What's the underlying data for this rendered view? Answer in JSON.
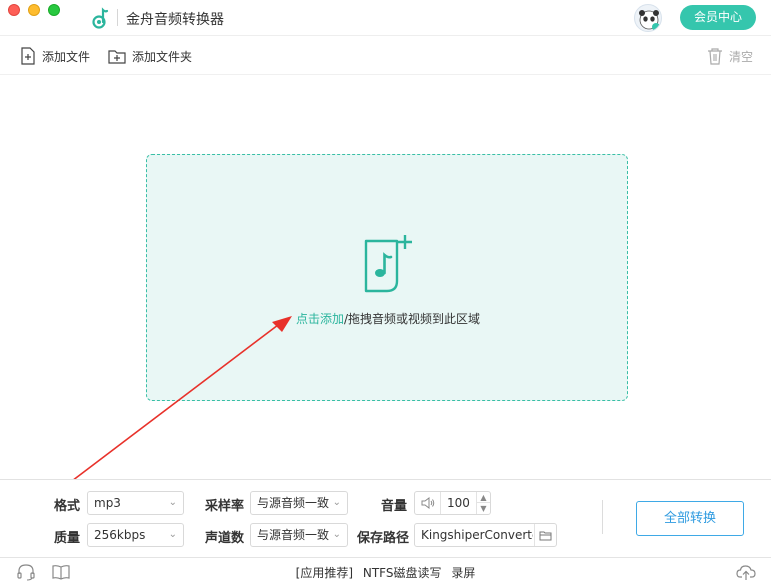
{
  "window": {
    "title": "金舟音频转换器",
    "vip_button": "会员中心"
  },
  "toolbar": {
    "add_file": "添加文件",
    "add_folder": "添加文件夹",
    "clear": "清空"
  },
  "dropzone": {
    "link_text": "点击添加",
    "rest_text": "/拖拽音频或视频到此区域"
  },
  "settings": {
    "format_label": "格式",
    "format_value": "mp3",
    "quality_label": "质量",
    "quality_value": "256kbps",
    "sample_rate_label": "采样率",
    "sample_rate_value": "与源音频一致",
    "channels_label": "声道数",
    "channels_value": "与源音频一致",
    "volume_label": "音量",
    "volume_value": "100",
    "save_path_label": "保存路径",
    "save_path_value": "KingshiperConverter",
    "convert_all_button": "全部转换"
  },
  "statusbar": {
    "app_recommend": "[应用推荐]",
    "ntfs": "NTFS磁盘读写",
    "screen_record": "录屏"
  },
  "colors": {
    "accent": "#35c6ad",
    "dropzone_bg": "#e9f7f5",
    "dropzone_border": "#39bfa6",
    "convert_button": "#2f9be0",
    "annotation_arrow": "#e8312a"
  },
  "icons": {
    "app_logo": "music-note-icon",
    "add_file": "file-plus-icon",
    "add_folder": "folder-plus-icon",
    "clear": "trash-icon",
    "drop": "music-file-plus-icon",
    "volume": "speaker-icon",
    "path": "folder-icon",
    "support": "headset-icon",
    "guide": "book-icon",
    "upload": "cloud-upload-icon"
  }
}
